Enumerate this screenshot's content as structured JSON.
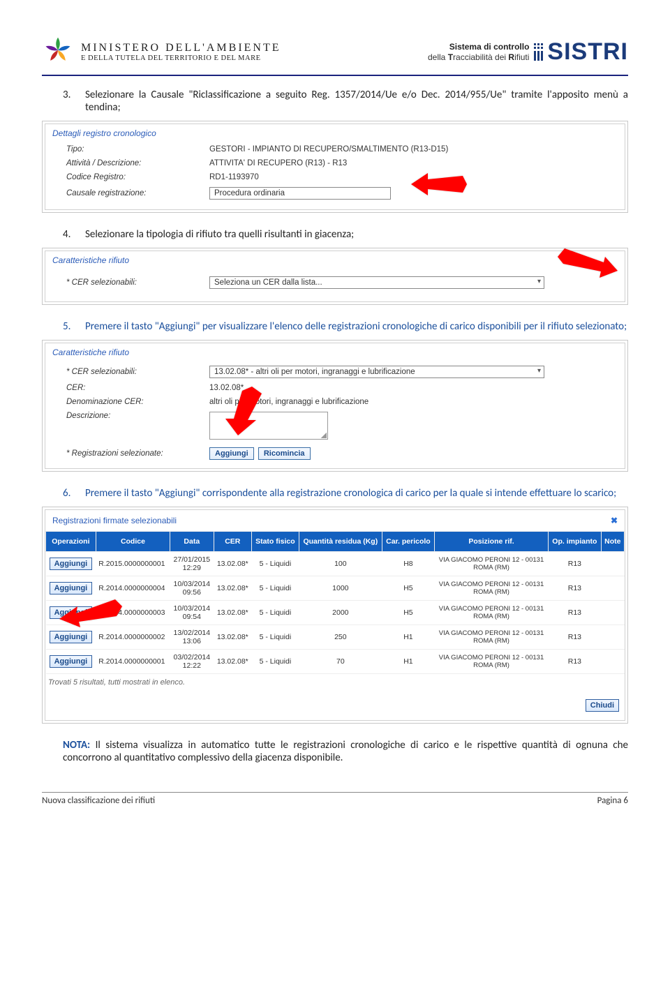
{
  "header": {
    "min_line1": "MINISTERO DELL'AMBIENTE",
    "min_line2": "E DELLA TUTELA DEL TERRITORIO E DEL MARE",
    "sis_line1": "Sistema di controllo",
    "sis_line2": "della Tracciabilità dei Rifiuti",
    "sistri": "SISTRI"
  },
  "steps": {
    "s3_num": "3.",
    "s3_txt": "Selezionare la Causale \"Riclassificazione a seguito Reg. 1357/2014/Ue e/o Dec. 2014/955/Ue\" tramite l'apposito menù a tendina;",
    "s4_num": "4.",
    "s4_txt": "Selezionare la tipologia di rifiuto tra quelli risultanti in giacenza;",
    "s5_num": "5.",
    "s5_txt": "Premere il tasto \"Aggiungi\" per visualizzare l'elenco delle registrazioni cronologiche di carico disponibili per il rifiuto selezionato;",
    "s6_num": "6.",
    "s6_txt": "Premere il tasto \"Aggiungi\" corrispondente alla registrazione cronologica di carico per la quale si intende effettuare lo scarico;"
  },
  "panel1": {
    "title": "Dettagli registro cronologico",
    "tipo_k": "Tipo:",
    "tipo_v": "GESTORI - IMPIANTO DI RECUPERO/SMALTIMENTO (R13-D15)",
    "att_k": "Attività / Descrizione:",
    "att_v": "ATTIVITA' DI RECUPERO (R13) - R13",
    "codice_k": "Codice Registro:",
    "codice_v": "RD1-1193970",
    "causale_k": "Causale registrazione:",
    "causale_v": "Procedura ordinaria"
  },
  "panel2": {
    "title": "Caratteristiche rifiuto",
    "cer_k": "* CER selezionabili:",
    "cer_placeholder": "Seleziona un CER dalla lista..."
  },
  "panel3": {
    "title": "Caratteristiche rifiuto",
    "cersel_k": "* CER selezionabili:",
    "cersel_v": "13.02.08* - altri oli per motori, ingranaggi e lubrificazione",
    "cer_k": "CER:",
    "cer_v": "13.02.08*",
    "den_k": "Denominazione CER:",
    "den_v": "altri oli per motori, ingranaggi e lubrificazione",
    "desc_k": "Descrizione:",
    "regsel_k": "* Registrazioni selezionate:",
    "aggiungi": "Aggiungi",
    "ricomincia": "Ricomincia"
  },
  "panel4": {
    "title": "Registrazioni firmate selezionabili",
    "headers": [
      "Operazioni",
      "Codice",
      "Data",
      "CER",
      "Stato fisico",
      "Quantità residua (Kg)",
      "Car. pericolo",
      "Posizione rif.",
      "Op. impianto",
      "Note"
    ],
    "rows": [
      {
        "op": "Aggiungi",
        "codice": "R.2015.0000000001",
        "data": "27/01/2015 12:29",
        "cer": "13.02.08*",
        "stato": "5 - Liquidi",
        "qta": "100",
        "car": "H8",
        "pos": "VIA GIACOMO PERONI 12 - 00131 ROMA (RM)",
        "opimp": "R13",
        "note": ""
      },
      {
        "op": "Aggiungi",
        "codice": "R.2014.0000000004",
        "data": "10/03/2014 09:56",
        "cer": "13.02.08*",
        "stato": "5 - Liquidi",
        "qta": "1000",
        "car": "H5",
        "pos": "VIA GIACOMO PERONI 12 - 00131 ROMA (RM)",
        "opimp": "R13",
        "note": ""
      },
      {
        "op": "Aggiungi",
        "codice": "R.2014.0000000003",
        "data": "10/03/2014 09:54",
        "cer": "13.02.08*",
        "stato": "5 - Liquidi",
        "qta": "2000",
        "car": "H5",
        "pos": "VIA GIACOMO PERONI 12 - 00131 ROMA (RM)",
        "opimp": "R13",
        "note": ""
      },
      {
        "op": "Aggiungi",
        "codice": "R.2014.0000000002",
        "data": "13/02/2014 13:06",
        "cer": "13.02.08*",
        "stato": "5 - Liquidi",
        "qta": "250",
        "car": "H1",
        "pos": "VIA GIACOMO PERONI 12 - 00131 ROMA (RM)",
        "opimp": "R13",
        "note": ""
      },
      {
        "op": "Aggiungi",
        "codice": "R.2014.0000000001",
        "data": "03/02/2014 12:22",
        "cer": "13.02.08*",
        "stato": "5 - Liquidi",
        "qta": "70",
        "car": "H1",
        "pos": "VIA GIACOMO PERONI 12 - 00131 ROMA (RM)",
        "opimp": "R13",
        "note": ""
      }
    ],
    "results": "Trovati 5 risultati, tutti mostrati in elenco.",
    "chiudi": "Chiudi"
  },
  "nota": {
    "label": "NOTA:",
    "txt": "Il sistema visualizza in automatico tutte le registrazioni cronologiche di carico e le rispettive quantità di ognuna che concorrono al quantitativo complessivo della giacenza disponibile."
  },
  "footer": {
    "left": "Nuova classificazione dei rifiuti",
    "right": "Pagina 6"
  }
}
